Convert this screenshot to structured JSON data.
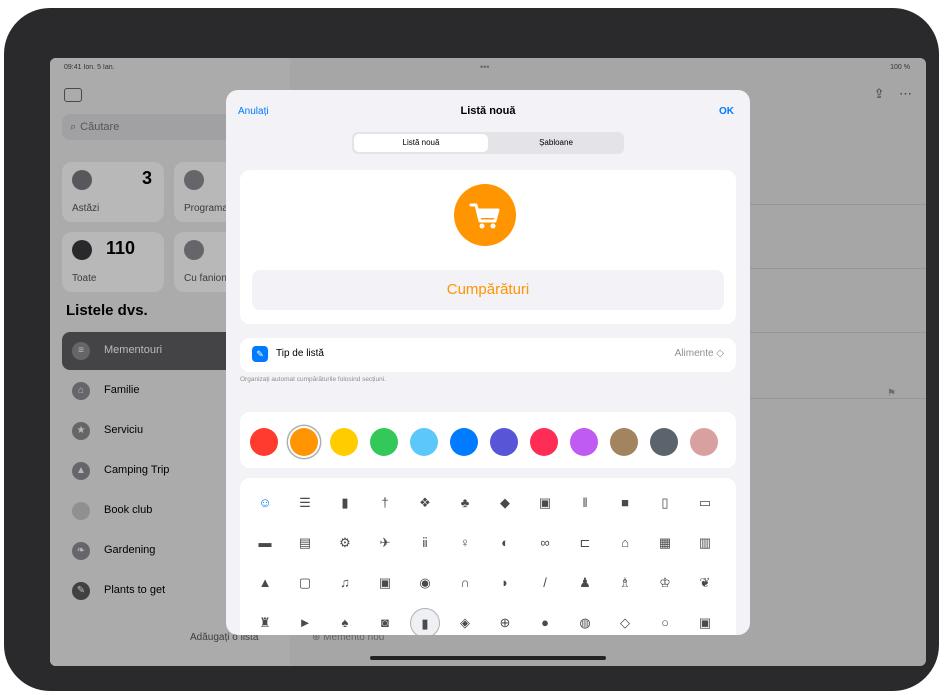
{
  "status": {
    "time": "09:41 Ion. 5 Ian.",
    "battery": "100 %",
    "dots": "•••"
  },
  "sidebar": {
    "search_placeholder": "Căutare",
    "tiles": [
      {
        "label": "Astăzi",
        "count": "3"
      },
      {
        "label": "Programate",
        "count": ""
      },
      {
        "label": "Toate",
        "count": "110"
      },
      {
        "label": "Cu fanion",
        "count": ""
      }
    ],
    "lists_title": "Listele dvs.",
    "items": [
      {
        "label": "Mementouri",
        "icon": "list-icon"
      },
      {
        "label": "Familie",
        "icon": "home-icon"
      },
      {
        "label": "Serviciu",
        "icon": "star-icon"
      },
      {
        "label": "Camping Trip",
        "icon": "tent-icon"
      },
      {
        "label": "Book club",
        "icon": "book-icon"
      },
      {
        "label": "Gardening",
        "icon": "leaf-icon"
      },
      {
        "label": "Plants to get",
        "icon": "pencil-icon"
      }
    ],
    "add_list_label": "Adăugați o listă"
  },
  "main": {
    "new_reminder_label": "Memento nou"
  },
  "modal": {
    "cancel_label": "Anulați",
    "title": "Listă nouă",
    "ok_label": "OK",
    "segments": [
      "Listă nouă",
      "Șabloane"
    ],
    "list_name": "Cumpărături",
    "list_color": "#ff9500",
    "list_icon": "cart-icon",
    "list_type_label": "Tip de listă",
    "list_type_value": "Alimente ◇",
    "hint": "Organizați automat cumpărăturile folosind secțiuni.",
    "colors": [
      "#ff3b30",
      "#ff9500",
      "#ffcc00",
      "#34c759",
      "#5ac8fa",
      "#007aff",
      "#5856d6",
      "#ff2d55",
      "#bf5af2",
      "#a2845e",
      "#5b636d",
      "#d8a1a0"
    ],
    "selected_color_index": 1,
    "icon_rows": [
      [
        "☺",
        "☰",
        "▮",
        "†",
        "❖",
        "♣",
        "◆",
        "▣",
        "‖",
        "■",
        "▯",
        "▭"
      ],
      [
        "▬",
        "▤",
        "⚙",
        "✈",
        "ⅱ",
        "♀",
        "◐",
        "∞",
        "⊏",
        "⌂",
        "▦",
        "▥"
      ],
      [
        "▲",
        "▢",
        "♫",
        "▣",
        "◉",
        "∩",
        "◗",
        "/",
        "♟",
        "♗",
        "♔",
        "❦"
      ],
      [
        "♜",
        "►",
        "♠",
        "◙",
        "▮",
        "◈",
        "⊕",
        "●",
        "◍",
        "◇",
        "○",
        "▣"
      ]
    ]
  }
}
